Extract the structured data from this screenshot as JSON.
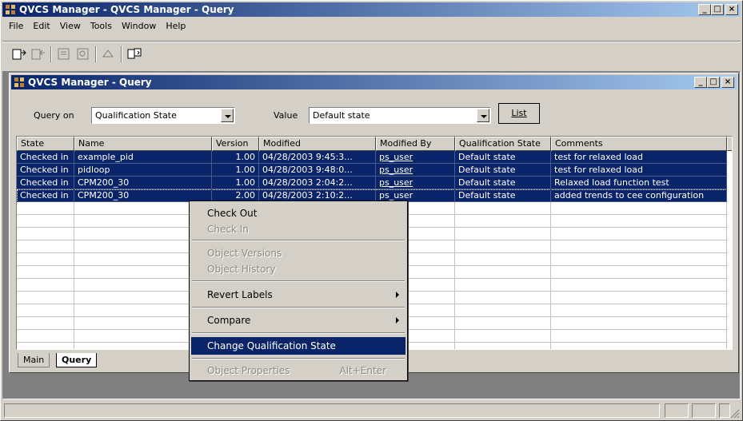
{
  "app": {
    "title": "QVCS Manager - QVCS Manager - Query",
    "menu": [
      "File",
      "Edit",
      "View",
      "Tools",
      "Window",
      "Help"
    ],
    "caption_buttons": [
      "_",
      "□",
      "×"
    ]
  },
  "toolbar": {
    "icons": [
      "check-out-icon",
      "check-in-icon",
      "properties-icon",
      "history-icon",
      "labels-icon",
      "compare-icon"
    ]
  },
  "child": {
    "title": "QVCS Manager - Query",
    "query_label": "Query on",
    "query_value": "Qualification State",
    "value_label": "Value",
    "value_value": "Default state",
    "list_button": "List"
  },
  "table": {
    "columns": [
      "State",
      "Name",
      "Version",
      "Modified",
      "Modified By",
      "Qualification State",
      "Comments"
    ],
    "rows": [
      [
        "Checked in",
        "example_pid",
        "1.00",
        "04/28/2003 9:45:3...",
        "ps_user",
        "Default state",
        "test for relaxed load"
      ],
      [
        "Checked in",
        "pidloop",
        "1.00",
        "04/28/2003 9:48:0...",
        "ps_user",
        "Default state",
        "test for relaxed load"
      ],
      [
        "Checked in",
        "CPM200_30",
        "1.00",
        "04/28/2003 2:04:2...",
        "ps_user",
        "Default state",
        "Relaxed load function test"
      ],
      [
        "Checked in",
        "CPM200_30",
        "2.00",
        "04/28/2003 2:10:2...",
        "ps_user",
        "Default state",
        "added trends to cee configuration"
      ]
    ]
  },
  "tabs": [
    "Main",
    "Query"
  ],
  "context_menu": {
    "items": [
      {
        "label": "Check Out",
        "state": "enabled"
      },
      {
        "label": "Check In",
        "state": "disabled"
      },
      {
        "label": "Object Versions",
        "state": "disabled"
      },
      {
        "label": "Object History",
        "state": "disabled"
      },
      {
        "label": "Revert Labels",
        "state": "enabled",
        "submenu": true
      },
      {
        "label": "Compare",
        "state": "enabled",
        "submenu": true
      },
      {
        "label": "Change Qualification State",
        "state": "highlighted"
      },
      {
        "label": "Object Properties",
        "state": "disabled",
        "shortcut": "Alt+Enter"
      }
    ]
  },
  "colors": {
    "titlebar_start": "#0a246a",
    "titlebar_end": "#a6caf0",
    "selection": "#0a246a",
    "face": "#d4d0c8"
  }
}
